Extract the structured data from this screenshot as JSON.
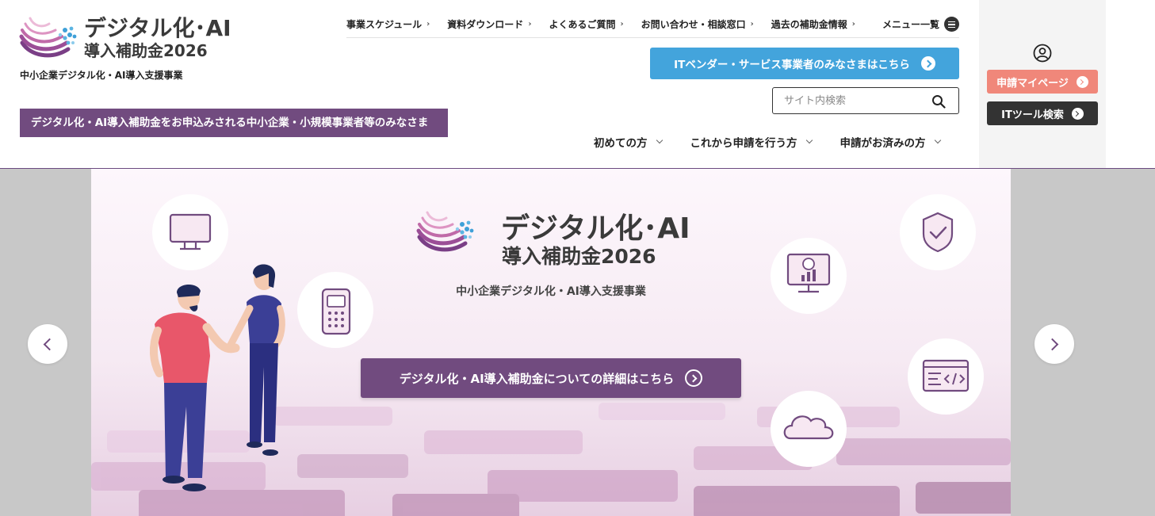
{
  "brand": {
    "title": "デジタル化･AI",
    "subtitle": "導入補助金2026",
    "tagline": "中小企業デジタル化・AI導入支援事業"
  },
  "audience_banner": "デジタル化・AI導入補助金をお申込みされる中小企業・小規模事業者等のみなさま",
  "topnav": {
    "items": [
      {
        "label": "事業スケジュール"
      },
      {
        "label": "資料ダウンロード"
      },
      {
        "label": "よくあるご質問"
      },
      {
        "label": "お問い合わせ・相談窓口"
      },
      {
        "label": "過去の補助金情報"
      }
    ],
    "menu_label": "メニュー一覧"
  },
  "vendor_button": "ITベンダー・サービス事業者のみなさまはこちら",
  "search": {
    "placeholder": "サイト内検索",
    "value": ""
  },
  "mainnav": {
    "items": [
      {
        "label": "初めての方"
      },
      {
        "label": "これから申請を行う方"
      },
      {
        "label": "申請がお済みの方"
      }
    ]
  },
  "side": {
    "mypage_label": "申請マイページ",
    "tool_search_label": "ITツール検索"
  },
  "hero": {
    "title": "デジタル化･AI",
    "subtitle": "導入補助金2026",
    "tagline": "中小企業デジタル化・AI導入支援事業",
    "cta": "デジタル化・AI導入補助金についての詳細はこちら",
    "icons": [
      "monitor-icon",
      "payment-terminal-icon",
      "yen-chart-icon",
      "shield-check-icon",
      "code-window-icon",
      "cloud-icon"
    ]
  },
  "colors": {
    "brand_purple": "#714b7f",
    "vendor_blue": "#43a4dc",
    "mypage_coral": "#f0877a",
    "dark": "#333333"
  }
}
